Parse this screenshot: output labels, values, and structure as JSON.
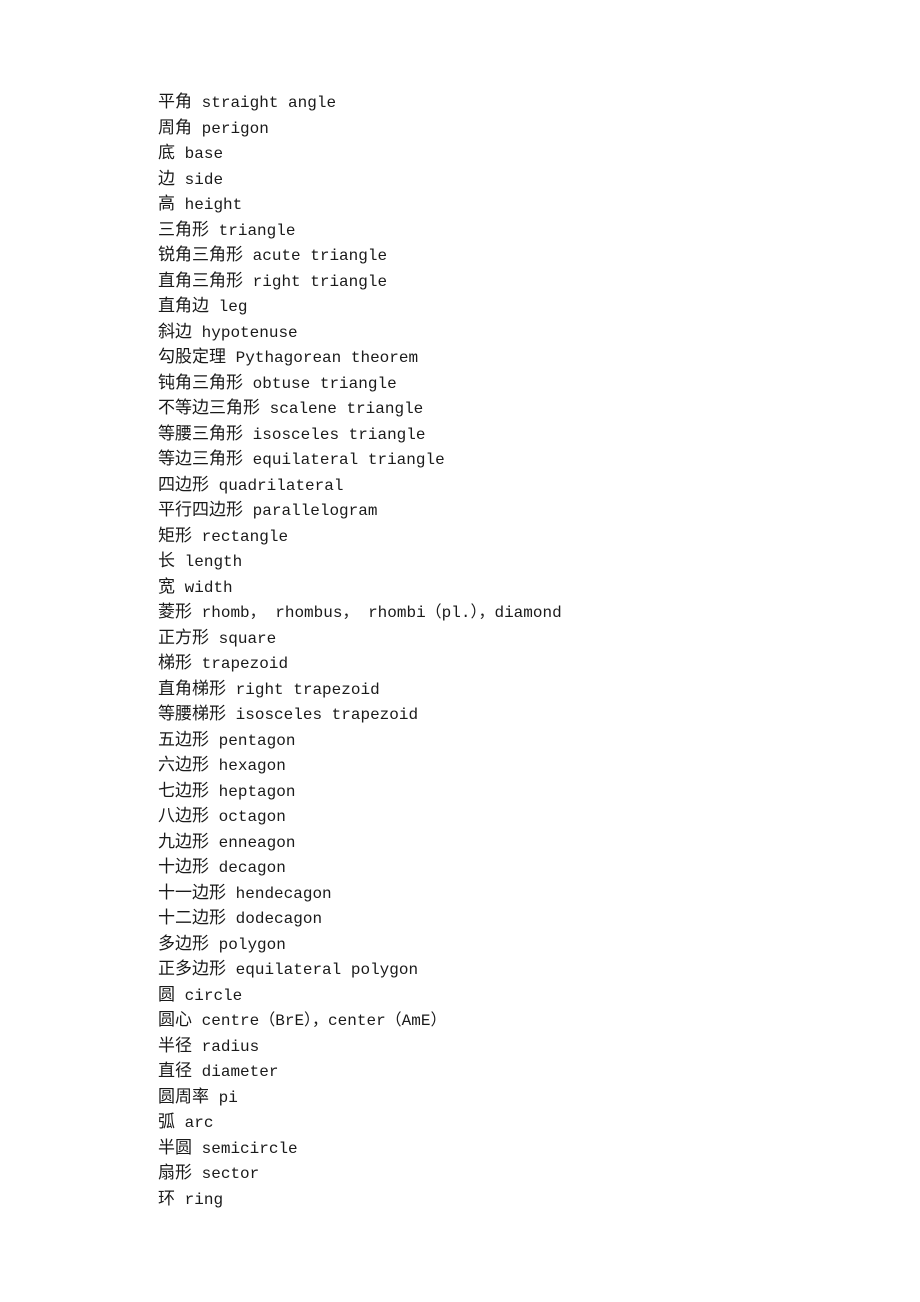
{
  "glossary": {
    "entries": [
      {
        "zh": "平角",
        "en": "straight angle"
      },
      {
        "zh": "周角",
        "en": "perigon"
      },
      {
        "zh": "底",
        "en": "base"
      },
      {
        "zh": "边",
        "en": "side"
      },
      {
        "zh": "高",
        "en": "height"
      },
      {
        "zh": "三角形",
        "en": "triangle"
      },
      {
        "zh": "锐角三角形",
        "en": "acute triangle"
      },
      {
        "zh": "直角三角形",
        "en": "right triangle"
      },
      {
        "zh": "直角边",
        "en": "leg"
      },
      {
        "zh": "斜边",
        "en": "hypotenuse"
      },
      {
        "zh": "勾股定理",
        "en": "Pythagorean theorem"
      },
      {
        "zh": "钝角三角形",
        "en": "obtuse triangle"
      },
      {
        "zh": "不等边三角形",
        "en": "scalene triangle"
      },
      {
        "zh": "等腰三角形",
        "en": "isosceles triangle"
      },
      {
        "zh": "等边三角形",
        "en": "equilateral triangle"
      },
      {
        "zh": "四边形",
        "en": "quadrilateral"
      },
      {
        "zh": "平行四边形",
        "en": "parallelogram"
      },
      {
        "zh": "矩形",
        "en": "rectangle"
      },
      {
        "zh": "长",
        "en": "length"
      },
      {
        "zh": "宽",
        "en": "width"
      },
      {
        "zh": "菱形",
        "en": "rhomb， rhombus， rhombi（pl.），diamond"
      },
      {
        "zh": "正方形",
        "en": "square"
      },
      {
        "zh": "梯形",
        "en": "trapezoid"
      },
      {
        "zh": "直角梯形",
        "en": "right trapezoid"
      },
      {
        "zh": "等腰梯形",
        "en": "isosceles trapezoid"
      },
      {
        "zh": "五边形",
        "en": "pentagon"
      },
      {
        "zh": "六边形",
        "en": "hexagon"
      },
      {
        "zh": "七边形",
        "en": "heptagon"
      },
      {
        "zh": "八边形",
        "en": "octagon"
      },
      {
        "zh": "九边形",
        "en": "enneagon"
      },
      {
        "zh": "十边形",
        "en": "decagon"
      },
      {
        "zh": "十一边形",
        "en": "hendecagon"
      },
      {
        "zh": "十二边形",
        "en": "dodecagon"
      },
      {
        "zh": "多边形",
        "en": "polygon"
      },
      {
        "zh": "正多边形",
        "en": "equilateral polygon"
      },
      {
        "zh": "圆",
        "en": "circle"
      },
      {
        "zh": "圆心",
        "en": "centre（BrE），center（AmE）"
      },
      {
        "zh": "半径",
        "en": "radius"
      },
      {
        "zh": "直径",
        "en": "diameter"
      },
      {
        "zh": "圆周率",
        "en": "pi"
      },
      {
        "zh": "弧",
        "en": "arc"
      },
      {
        "zh": "半圆",
        "en": "semicircle"
      },
      {
        "zh": "扇形",
        "en": "sector"
      },
      {
        "zh": "环",
        "en": "ring"
      }
    ]
  }
}
